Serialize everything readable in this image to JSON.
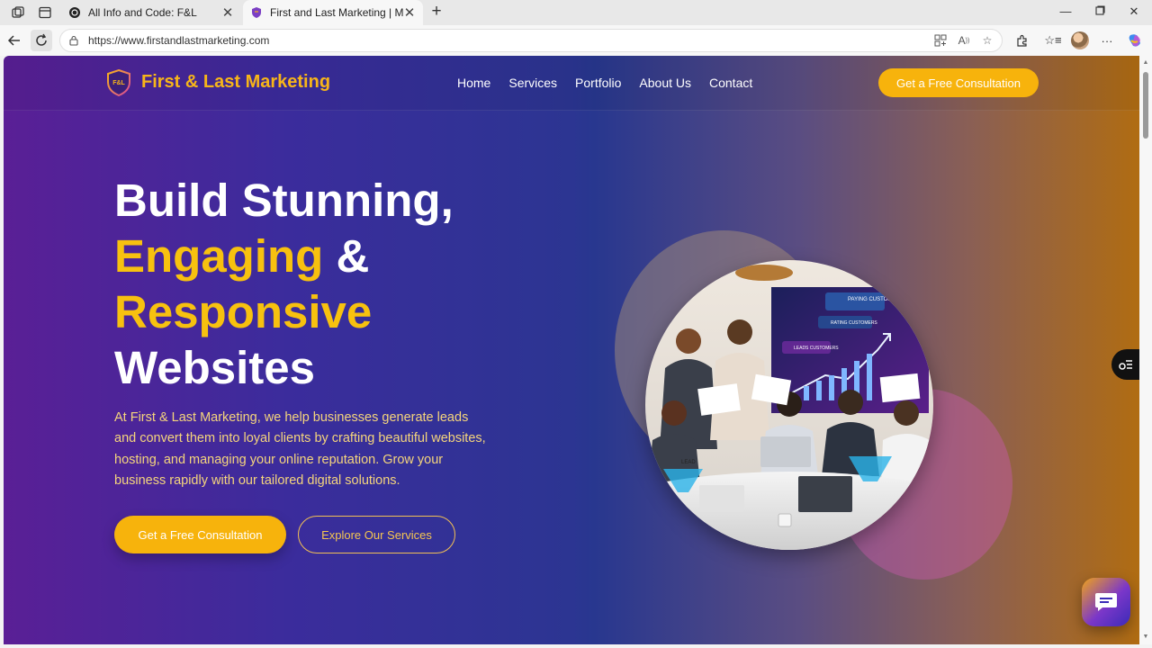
{
  "browser": {
    "tabs": [
      {
        "title": "All Info and Code: F&L",
        "active": false
      },
      {
        "title": "First and Last Marketing | Missour",
        "active": true
      }
    ],
    "url": "https://www.firstandlastmarketing.com"
  },
  "site": {
    "logo_text": "First & Last Marketing",
    "logo_badge": "F&L",
    "nav": [
      "Home",
      "Services",
      "Portfolio",
      "About Us",
      "Contact"
    ],
    "header_cta": "Get a Free Consultation"
  },
  "hero": {
    "line1": "Build Stunning,",
    "line2_accent": "Engaging",
    "line2_rest": " &",
    "line3_accent": "Responsive",
    "line4": "Websites",
    "description": "At First & Last Marketing, we help businesses generate leads and convert them into loyal clients by crafting beautiful websites, hosting, and managing your online reputation. Grow your business rapidly with our tailored digital solutions.",
    "primary_button": "Get a Free Consultation",
    "secondary_button": "Explore Our Services"
  },
  "image_text": {
    "paying_customers": "PAYING CUSTOMERS",
    "ratings_customers": "RATING CUSTOMERS",
    "leads_customers": "LEADS CUSTOMERS",
    "lead": "LEAD"
  },
  "colors": {
    "accent": "#f7b30c",
    "accent_text": "#f7c10f",
    "description_text": "#f5d57c"
  },
  "icons": [
    "workspaces-icon",
    "tab-actions-icon",
    "favicon-icon",
    "close-icon",
    "plus-icon",
    "minimize-icon",
    "maximize-icon",
    "back-icon",
    "reload-icon",
    "lock-icon",
    "app-available-icon",
    "read-aloud-icon",
    "favorite-icon",
    "extensions-icon",
    "favorites-icon",
    "more-icon",
    "copilot-icon",
    "sidebar-toggle-icon",
    "chat-icon"
  ]
}
